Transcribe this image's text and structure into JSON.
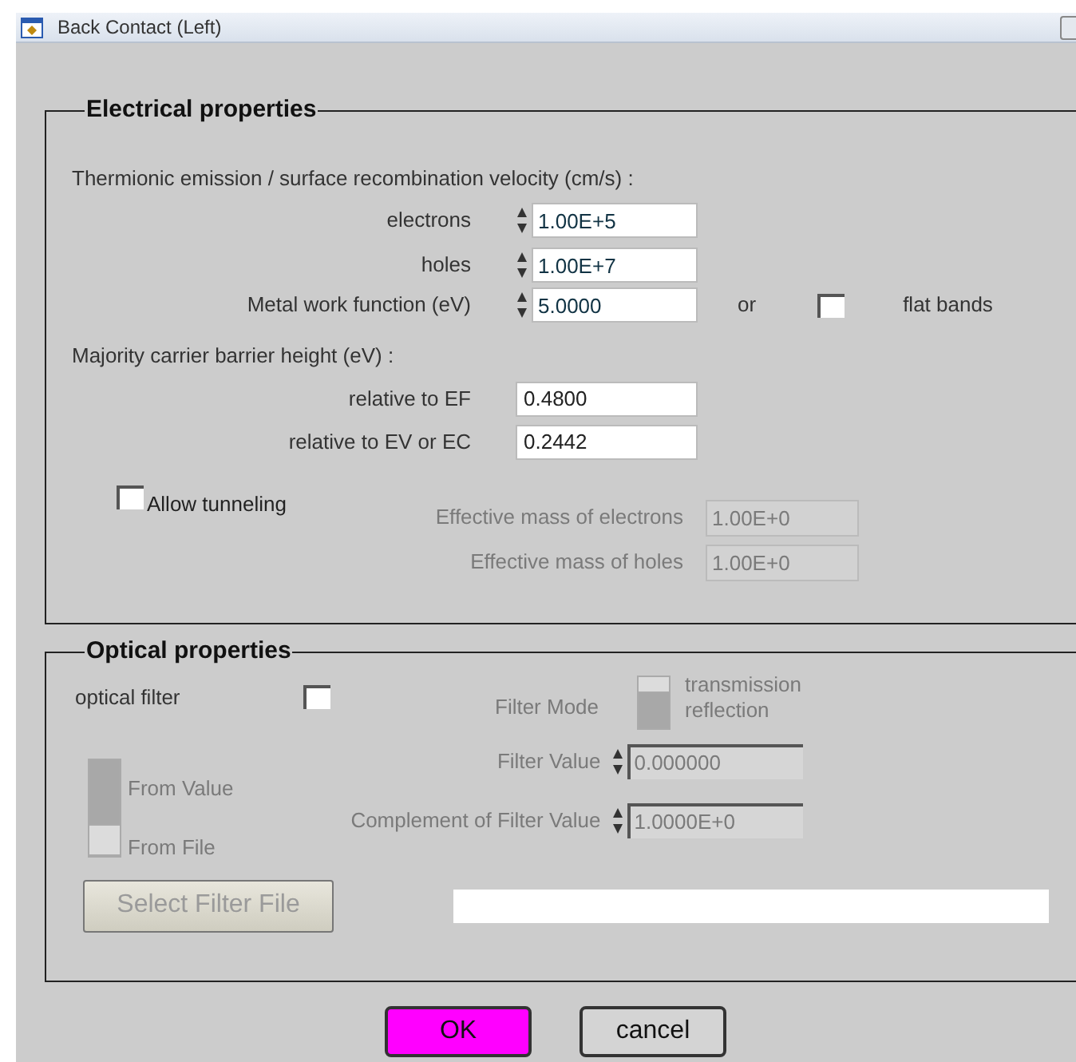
{
  "window": {
    "title": "Back Contact (Left)"
  },
  "electrical": {
    "legend": "Electrical properties",
    "velocity_heading": "Thermionic emission / surface recombination velocity (cm/s) :",
    "velocity_rows": [
      {
        "label": "electrons",
        "value": "1.00E+5"
      },
      {
        "label": "holes",
        "value": "1.00E+7"
      }
    ],
    "work_function": {
      "label": "Metal work function (eV)",
      "value": "5.0000",
      "or_text": "or"
    },
    "flat_bands": {
      "label": "flat bands",
      "checked": false
    },
    "barrier_heading": "Majority carrier barrier height (eV) :",
    "barrier_rows": [
      {
        "label": "relative to EF",
        "value": "0.4800"
      },
      {
        "label": "relative to EV or EC",
        "value": "0.2442"
      }
    ],
    "tunneling": {
      "label": "Allow tunneling",
      "checked": false
    },
    "mass_rows": [
      {
        "label": "Effective mass of electrons",
        "value": "1.00E+0",
        "disabled": true
      },
      {
        "label": "Effective mass of holes",
        "value": "1.00E+0",
        "disabled": true
      }
    ]
  },
  "optical": {
    "legend": "Optical properties",
    "disabled": true,
    "optical_filter": {
      "label": "optical filter",
      "checked": false
    },
    "filter_mode": {
      "label": "Filter Mode",
      "options": [
        {
          "label": "transmission",
          "selected": false
        },
        {
          "label": "reflection",
          "selected": true
        }
      ]
    },
    "source": [
      {
        "label": "From Value",
        "selected": true
      },
      {
        "label": "From File",
        "selected": false
      }
    ],
    "value_rows": [
      {
        "label": "Filter Value",
        "value": "0.000000"
      },
      {
        "label": "Complement of Filter Value",
        "value": "1.0000E+0"
      }
    ],
    "select_button": "Select Filter File"
  },
  "buttons": [
    {
      "label": "OK",
      "kind": "primary"
    },
    {
      "label": "cancel",
      "kind": "normal"
    }
  ]
}
